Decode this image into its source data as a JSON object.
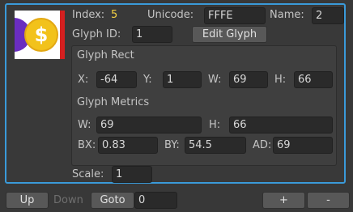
{
  "glyph": {
    "index_label": "Index:",
    "index_value": "5",
    "unicode_label": "Unicode:",
    "unicode_value": "FFFE",
    "name_label": "Name:",
    "name_value": "2",
    "glyph_id_label": "Glyph ID:",
    "glyph_id_value": "1",
    "edit_button": "Edit Glyph",
    "rect_heading": "Glyph Rect",
    "rect": {
      "x_label": "X:",
      "x_value": "-64",
      "y_label": "Y:",
      "y_value": "1",
      "w_label": "W:",
      "w_value": "69",
      "h_label": "H:",
      "h_value": "66"
    },
    "metrics_heading": "Glyph Metrics",
    "metrics": {
      "w_label": "W:",
      "w_value": "69",
      "h_label": "H:",
      "h_value": "66",
      "bx_label": "BX:",
      "bx_value": "0.83",
      "by_label": "BY:",
      "by_value": "54.5",
      "ad_label": "AD:",
      "ad_value": "69"
    },
    "scale_label": "Scale:",
    "scale_value": "1"
  },
  "thumbnail": {
    "coin_symbol": "$"
  },
  "footer": {
    "up": "Up",
    "down": "Down",
    "goto": "Goto",
    "goto_value": "0",
    "plus": "+",
    "minus": "-"
  },
  "colors": {
    "accent_border": "#3a9ad9",
    "index_highlight": "#f5d244"
  }
}
